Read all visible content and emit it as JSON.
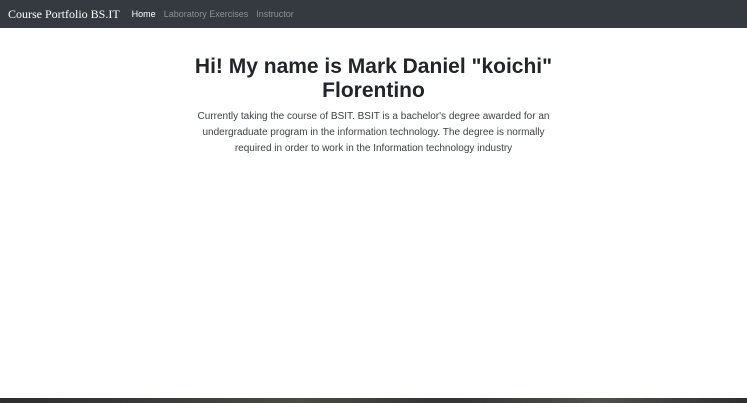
{
  "navbar": {
    "brand": "Course Portfolio BS.IT",
    "links": [
      {
        "label": "Home",
        "active": true
      },
      {
        "label": "Laboratory Exercises",
        "active": false
      },
      {
        "label": "Instructor",
        "active": false
      }
    ]
  },
  "hero": {
    "heading": "Hi! My name is Mark Daniel \"koichi\" Florentino",
    "description": "Currently taking the course of BSIT. BSIT is a bachelor's degree awarded for an undergraduate program in the information technology. The degree is normally required in order to work in the Information technology industry"
  },
  "colors": {
    "navbar_bg": "#343a40",
    "nav_active": "#ffffff",
    "nav_inactive": "#8a9096"
  }
}
